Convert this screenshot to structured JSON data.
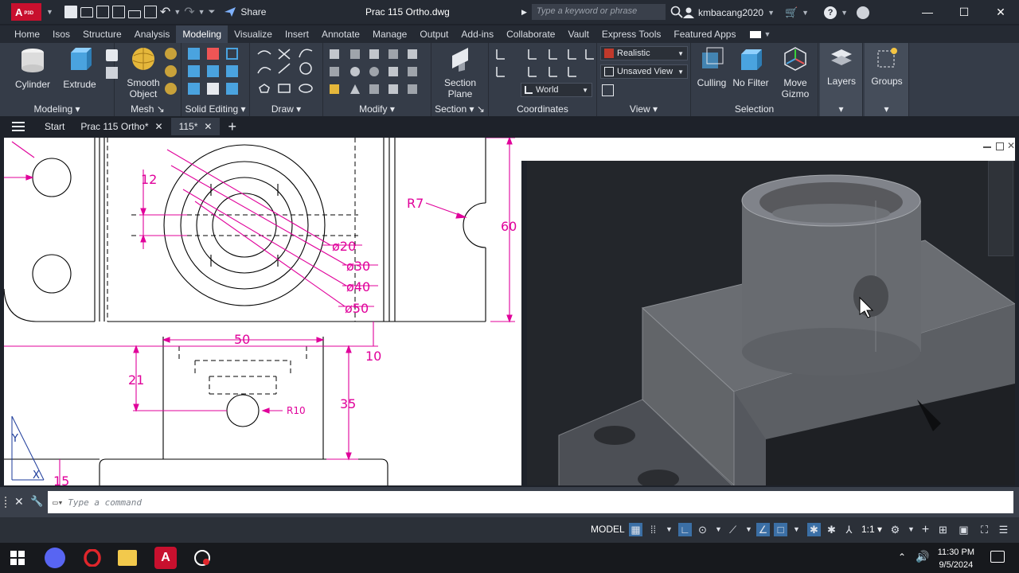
{
  "titlebar": {
    "app_logo": "A",
    "app_logo_sub": "P3D",
    "share_label": "Share",
    "document_title": "Prac 115 Ortho.dwg",
    "search_placeholder": "Type a keyword or phrase",
    "username": "kmbacang2020"
  },
  "ribbon_tabs": [
    "Home",
    "Isos",
    "Structure",
    "Analysis",
    "Modeling",
    "Visualize",
    "Insert",
    "Annotate",
    "Manage",
    "Output",
    "Add-ins",
    "Collaborate",
    "Vault",
    "Express Tools",
    "Featured Apps"
  ],
  "active_ribbon_tab": "Modeling",
  "ribbon": {
    "cylinder": "Cylinder",
    "extrude": "Extrude",
    "smooth_object_1": "Smooth",
    "smooth_object_2": "Object",
    "section_plane_1": "Section",
    "section_plane_2": "Plane",
    "culling": "Culling",
    "no_filter": "No Filter",
    "move_gizmo_1": "Move",
    "move_gizmo_2": "Gizmo",
    "layers": "Layers",
    "groups": "Groups",
    "visual_style": "Realistic",
    "named_view": "Unsaved View",
    "ucs": "World",
    "panels": {
      "modeling": "Modeling",
      "mesh": "Mesh",
      "solid_editing": "Solid Editing",
      "draw": "Draw",
      "modify": "Modify",
      "section": "Section",
      "coordinates": "Coordinates",
      "view": "View",
      "selection": "Selection"
    }
  },
  "file_tabs": {
    "start": "Start",
    "tab1": "Prac 115 Ortho*",
    "tab2": "115*"
  },
  "drawing": {
    "dim_12": "12",
    "dia20": "ø20",
    "dia30": "ø30",
    "dia40": "ø40",
    "dia50": "ø50",
    "r7": "R7",
    "dim_60": "60",
    "dim_50": "50",
    "dim_10": "10",
    "dim_21": "21",
    "r10": "R10",
    "dim_35": "35",
    "dim_15": "15",
    "ucs_y": "Y",
    "ucs_x": "X"
  },
  "command": {
    "placeholder": "Type a command"
  },
  "status": {
    "model": "MODEL",
    "scale": "1:1"
  },
  "taskbar": {
    "time": "11:30 PM",
    "date": "9/5/2024"
  }
}
